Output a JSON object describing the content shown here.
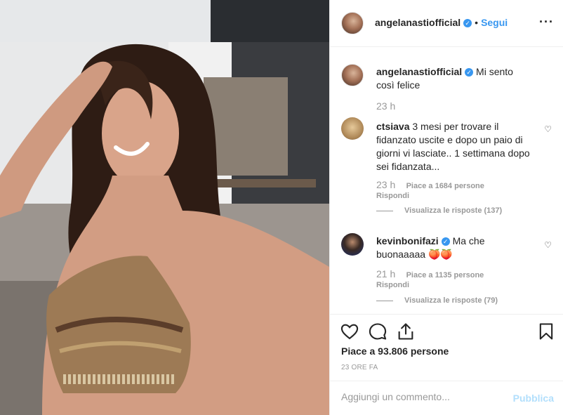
{
  "header": {
    "username": "angelanastiofficial",
    "separator": "•",
    "follow_label": "Segui",
    "more_icon": "more-options-icon"
  },
  "caption": {
    "username": "angelanastiofficial",
    "text": "Mi sento così felice",
    "time": "23 h"
  },
  "comments": [
    {
      "username": "ctsiava",
      "text": "3 mesi per trovare il fidanzato uscite e dopo un paio di giorni vi lasciate.. 1 settimana dopo sei fidanzata...",
      "time": "23 h",
      "likes": "Piace a 1684 persone",
      "reply": "Rispondi",
      "thread": "Visualizza le risposte (137)"
    },
    {
      "username": "kevinbonifazi",
      "text": "Ma che buonaaaaa 🍑🍑",
      "time": "21 h",
      "likes": "Piace a 1135 persone",
      "reply": "Rispondi",
      "thread": "Visualizza le risposte (79)"
    }
  ],
  "post": {
    "likes": "Piace a 93.806 persone",
    "time_ago": "23 ORE FA"
  },
  "add_comment": {
    "placeholder": "Aggiungi un commento...",
    "publish_label": "Pubblica"
  },
  "colors": {
    "accent": "#3897f0",
    "muted": "#999999",
    "publish_disabled": "#b2dffc"
  }
}
